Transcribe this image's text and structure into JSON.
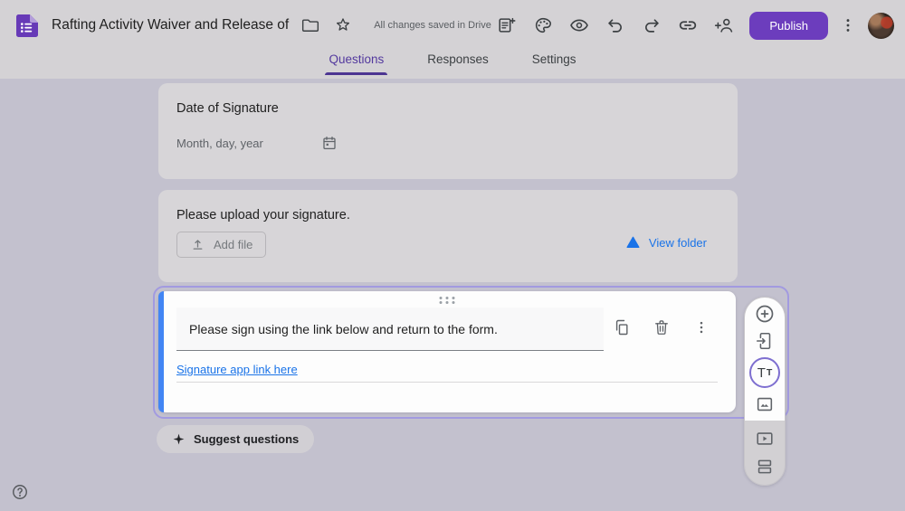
{
  "header": {
    "title": "Rafting Activity Waiver and Release of",
    "saved_status": "All changes saved in Drive",
    "publish_label": "Publish"
  },
  "tabs": {
    "questions": "Questions",
    "responses": "Responses",
    "settings": "Settings"
  },
  "cards": {
    "date": {
      "question": "Date of Signature",
      "placeholder": "Month, day, year"
    },
    "upload": {
      "question": "Please upload your signature.",
      "add_file": "Add file",
      "view_folder": "View folder"
    },
    "active": {
      "question": "Please sign using the link below and return to the form.",
      "link": "Signature app link here"
    }
  },
  "toolbar": {
    "text_icon_big": "T",
    "text_icon_small": "T"
  },
  "suggest": {
    "label": "Suggest questions"
  },
  "icons": {
    "help": "?"
  },
  "colors": {
    "publish_purple": "#6c3dbd",
    "tab_active_purple": "#53399e",
    "selection_outline_purple": "#a29ae0",
    "question_bar_blue": "#4285f4",
    "link_blue": "#1a73e8",
    "body_background": "#c3c1ce",
    "header_background": "#d4d2d5",
    "card_background": "#d7d5d8"
  }
}
